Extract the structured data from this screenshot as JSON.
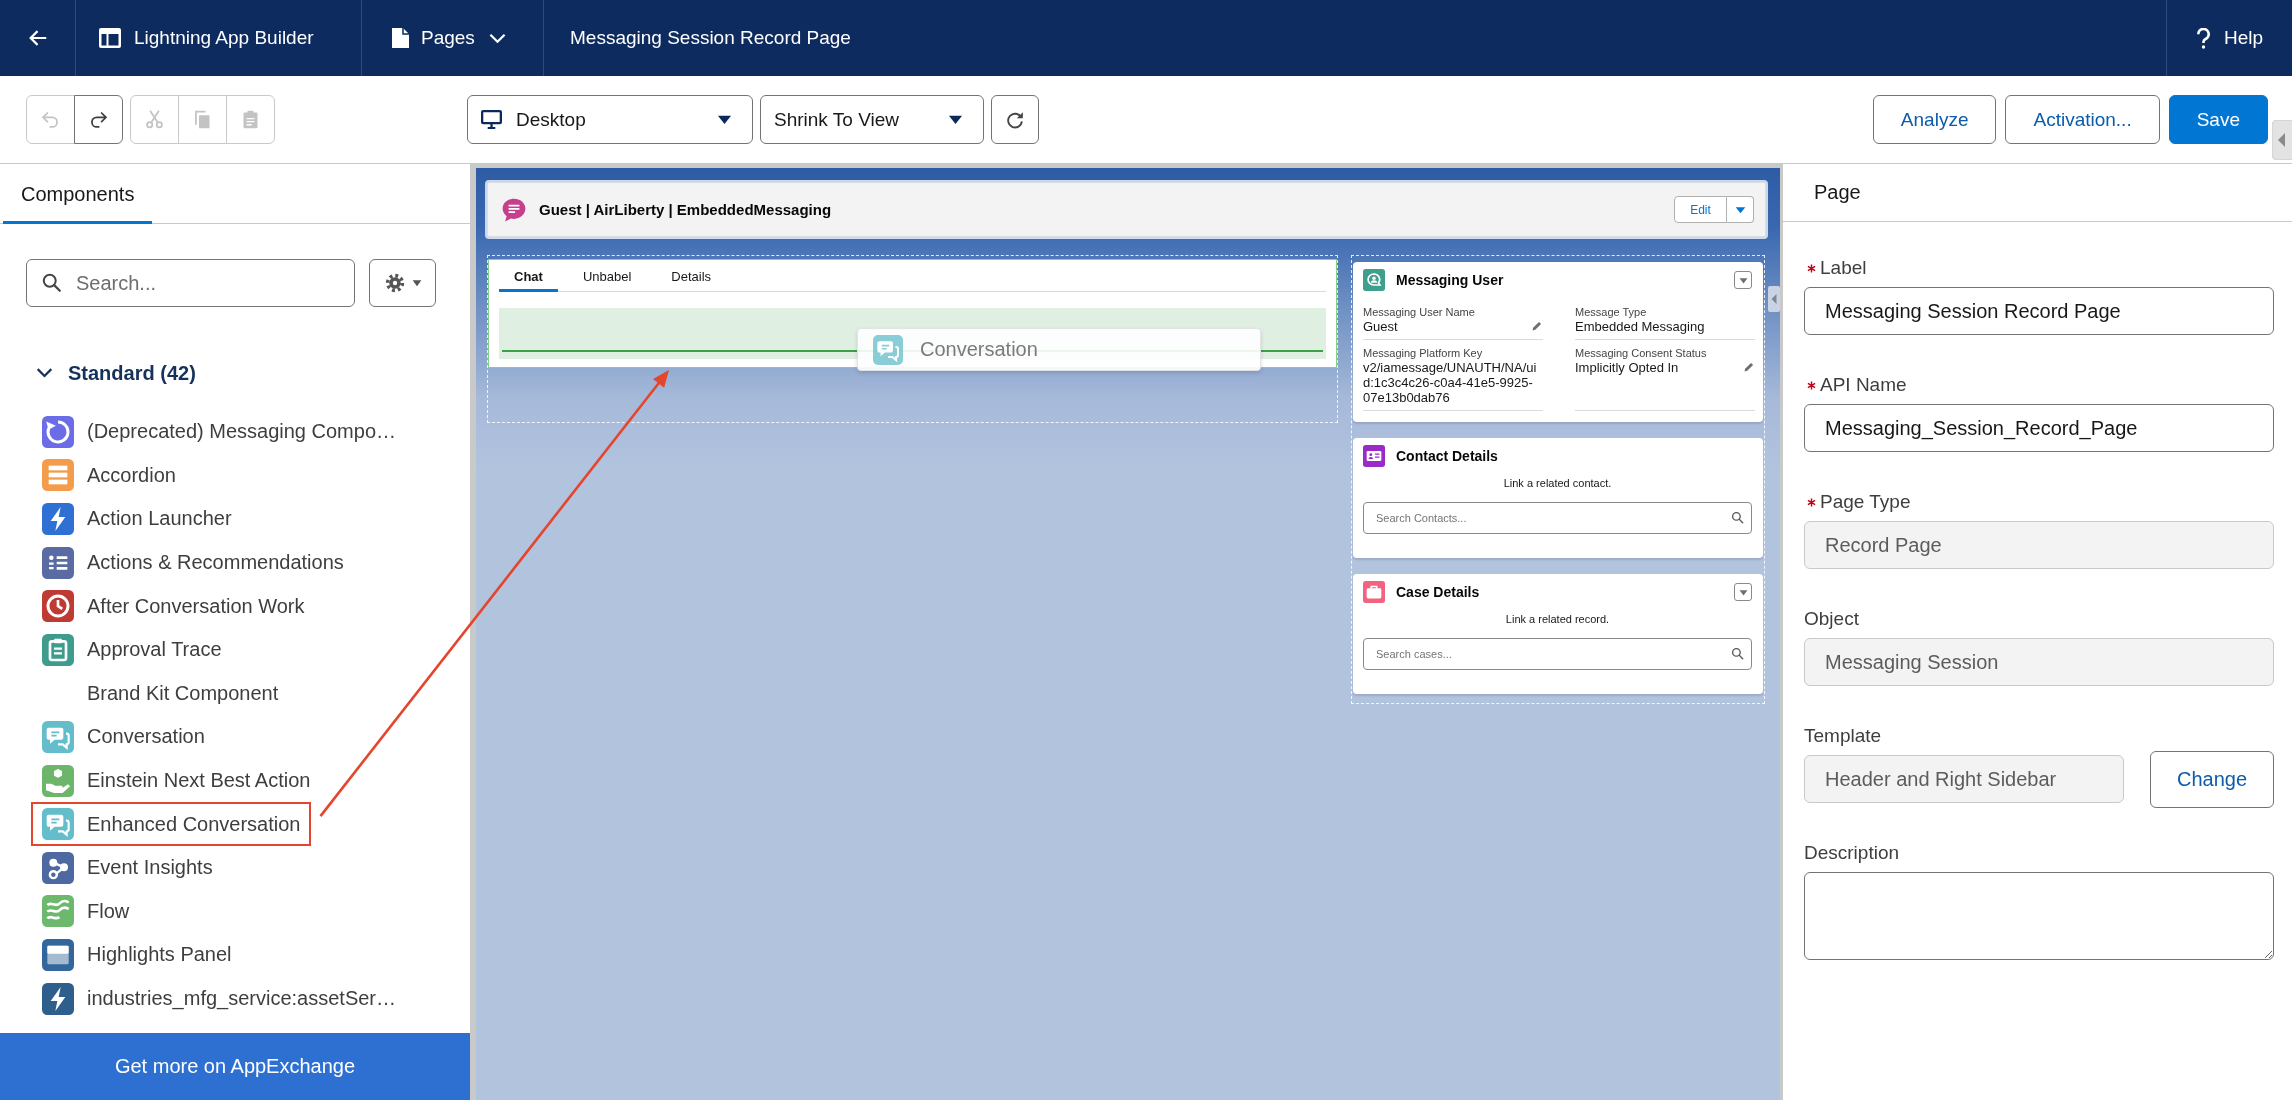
{
  "top_bar": {
    "app_title": "Lightning App Builder",
    "menu": "Pages",
    "page_title": "Messaging Session Record Page",
    "help": "Help"
  },
  "toolbar": {
    "history": [
      {
        "kind": "undo",
        "disabled": true
      },
      {
        "kind": "redo",
        "disabled": false
      }
    ],
    "clipboard": [
      {
        "kind": "cut",
        "disabled": true
      },
      {
        "kind": "copy",
        "disabled": true
      },
      {
        "kind": "paste",
        "disabled": true
      }
    ],
    "device": "Desktop",
    "zoom": "Shrink To View",
    "actions": [
      {
        "label": "Analyze",
        "kind": "neutral"
      },
      {
        "label": "Activation...",
        "kind": "neutral"
      },
      {
        "label": "Save",
        "kind": "brand"
      }
    ]
  },
  "components": {
    "tabs": [
      {
        "label": "Components",
        "selected": true
      }
    ],
    "search": {
      "placeholder": "Search..."
    },
    "section": {
      "title": "Standard (42)",
      "expanded": true,
      "items": [
        {
          "label": "(Deprecated) Messaging Compo…",
          "icon": {
            "kind": "messaging",
            "color": "#6b6de6"
          },
          "highlighted": false
        },
        {
          "label": "Accordion",
          "icon": {
            "kind": "accordion",
            "color": "#f49c4b"
          },
          "highlighted": false
        },
        {
          "label": "Action Launcher",
          "icon": {
            "kind": "lightning",
            "color": "#2f70d5"
          },
          "highlighted": false
        },
        {
          "label": "Actions & Recommendations",
          "icon": {
            "kind": "list",
            "color": "#5a6aa3"
          },
          "highlighted": false
        },
        {
          "label": "After Conversation Work",
          "icon": {
            "kind": "clock",
            "color": "#bf3a32"
          },
          "highlighted": false
        },
        {
          "label": "Approval Trace",
          "icon": {
            "kind": "clipboard",
            "color": "#3d9c8b"
          },
          "highlighted": false
        },
        {
          "label": "Brand Kit Component",
          "highlighted": false
        },
        {
          "label": "Conversation",
          "icon": {
            "kind": "chat",
            "color": "#63bdca"
          },
          "highlighted": false
        },
        {
          "label": "Einstein Next Best Action",
          "icon": {
            "kind": "hand",
            "color": "#6cb56b"
          },
          "highlighted": false
        },
        {
          "label": "Enhanced Conversation",
          "icon": {
            "kind": "chat",
            "color": "#63bdca"
          },
          "highlighted": true
        },
        {
          "label": "Event Insights",
          "icon": {
            "kind": "nodes",
            "color": "#4e68a2"
          },
          "highlighted": false
        },
        {
          "label": "Flow",
          "icon": {
            "kind": "flow",
            "color": "#6cb86c"
          },
          "highlighted": false
        },
        {
          "label": "Highlights Panel",
          "icon": {
            "kind": "panel",
            "color": "#33669a"
          },
          "highlighted": false
        },
        {
          "label": "industries_mfg_service:assetSer…",
          "icon": {
            "kind": "lightning",
            "color": "#2e5e8c"
          },
          "highlighted": false
        }
      ]
    },
    "footer": "Get more on AppExchange"
  },
  "canvas": {
    "header": {
      "title": "Guest | AirLiberty | EmbeddedMessaging",
      "buttons": [
        "Edit"
      ]
    },
    "main": {
      "tabs": [
        {
          "label": "Chat",
          "selected": true
        },
        {
          "label": "Unbabel",
          "selected": false
        },
        {
          "label": "Details",
          "selected": false
        }
      ],
      "drag_preview": {
        "label": "Conversation"
      }
    },
    "sidebar": [
      {
        "kind": "fields",
        "title": "Messaging User",
        "icon": {
          "kind": "user",
          "color": "#3da08f"
        },
        "menu": true,
        "fields": [
          {
            "label": "Messaging User Name",
            "value": "Guest",
            "editable": true
          },
          {
            "label": "Message Type",
            "value": "Embedded Messaging",
            "editable": false
          },
          {
            "label": "Messaging Platform Key",
            "value": "v2/iamessage/UNAUTH/NA/uid:1c3c4c26-c0a4-41e5-9925-07e13b0dab76",
            "editable": false
          },
          {
            "label": "Messaging Consent Status",
            "value": "Implicitly Opted In",
            "editable": true
          }
        ]
      },
      {
        "kind": "lookup",
        "title": "Contact Details",
        "icon": {
          "kind": "contact",
          "color": "#9b2bc8"
        },
        "menu": false,
        "hint": "Link a related contact.",
        "placeholder": "Search Contacts..."
      },
      {
        "kind": "lookup",
        "title": "Case Details",
        "icon": {
          "kind": "case",
          "color": "#f2637f"
        },
        "menu": true,
        "hint": "Link a related record.",
        "placeholder": "Search cases..."
      }
    ]
  },
  "properties": {
    "title": "Page",
    "fields": [
      {
        "label": "Label",
        "kind": "text",
        "required": true,
        "disabled": false,
        "value": "Messaging Session Record Page"
      },
      {
        "label": "API Name",
        "kind": "text",
        "required": true,
        "disabled": false,
        "value": "Messaging_Session_Record_Page"
      },
      {
        "label": "Page Type",
        "kind": "text",
        "required": true,
        "disabled": true,
        "value": "Record Page"
      },
      {
        "label": "Object",
        "kind": "text",
        "required": false,
        "disabled": true,
        "value": "Messaging Session"
      },
      {
        "label": "Template",
        "kind": "text",
        "required": false,
        "disabled": true,
        "value": "Header and Right Sidebar",
        "button": "Change"
      },
      {
        "label": "Description",
        "kind": "textarea",
        "required": false,
        "disabled": false
      }
    ]
  }
}
